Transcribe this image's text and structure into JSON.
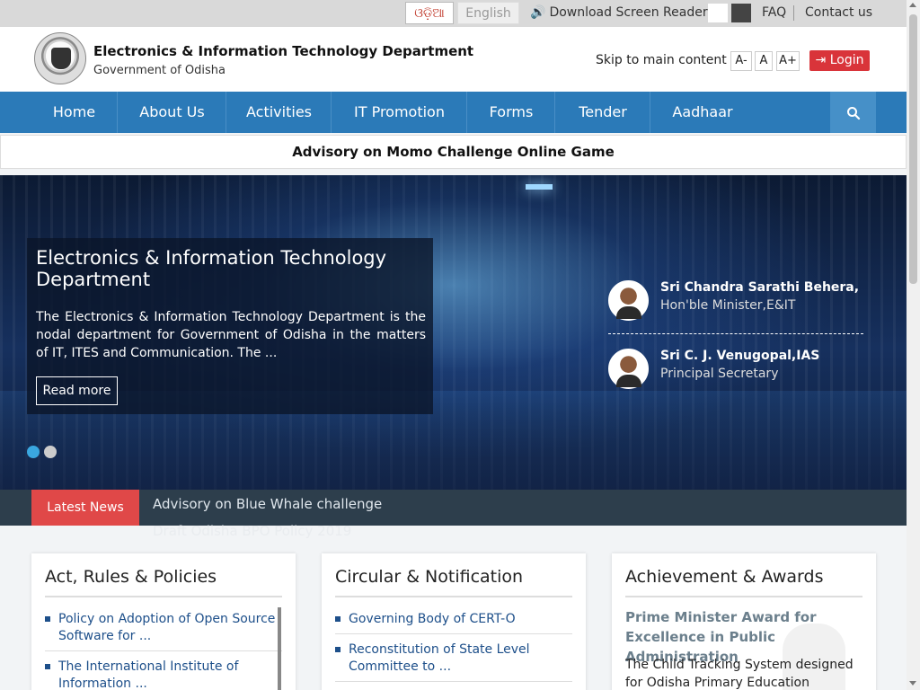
{
  "topbar": {
    "lang_odia": "ଓଡ଼ିଆ",
    "lang_english": "English",
    "screen_reader": "Download Screen Reader",
    "faq": "FAQ",
    "contact": "Contact us"
  },
  "header": {
    "title": "Electronics & Information Technology Department",
    "subtitle": "Government of Odisha",
    "skip": "Skip to main content",
    "font_decrease": "A-",
    "font_normal": "A",
    "font_increase": "A+",
    "login": "Login"
  },
  "nav": {
    "items": [
      "Home",
      "About Us",
      "Activities",
      "IT Promotion",
      "Forms",
      "Tender",
      "Aadhaar"
    ]
  },
  "advisory": "Advisory on Momo Challenge Online Game",
  "hero": {
    "title": "Electronics & Information Technology Department",
    "text": "The Electronics & Information Technology Department is the nodal department for Government of Odisha in the matters of IT, ITES and Communication. The ...",
    "read_more": "Read more",
    "people": [
      {
        "name": "Sri Chandra Sarathi Behera,",
        "role": "Hon'ble Minister,E&IT"
      },
      {
        "name": "Sri C. J. Venugopal,IAS",
        "role": "Principal Secretary"
      }
    ]
  },
  "news": {
    "label": "Latest News",
    "items": [
      "Advisory on Blue Whale challenge",
      "Draft Odisha BPO Policy 2019"
    ]
  },
  "cards": {
    "acts": {
      "title": "Act, Rules & Policies",
      "items": [
        "Policy on Adoption of Open Source Software for ...",
        "The International Institute of Information ..."
      ]
    },
    "circulars": {
      "title": "Circular & Notification",
      "items": [
        "Governing Body of CERT-O",
        "Reconstitution of State Level Committee to ..."
      ]
    },
    "awards": {
      "title": "Achievement & Awards",
      "headline": "Prime Minister Award for Excellence in Public Administration",
      "text": "The Child Tracking System designed for Odisha Primary Education"
    }
  },
  "colors": {
    "nav_blue": "#2b7ab8",
    "login_red": "#d9343a",
    "news_red": "#e04848",
    "link_blue": "#1d4f8a"
  }
}
